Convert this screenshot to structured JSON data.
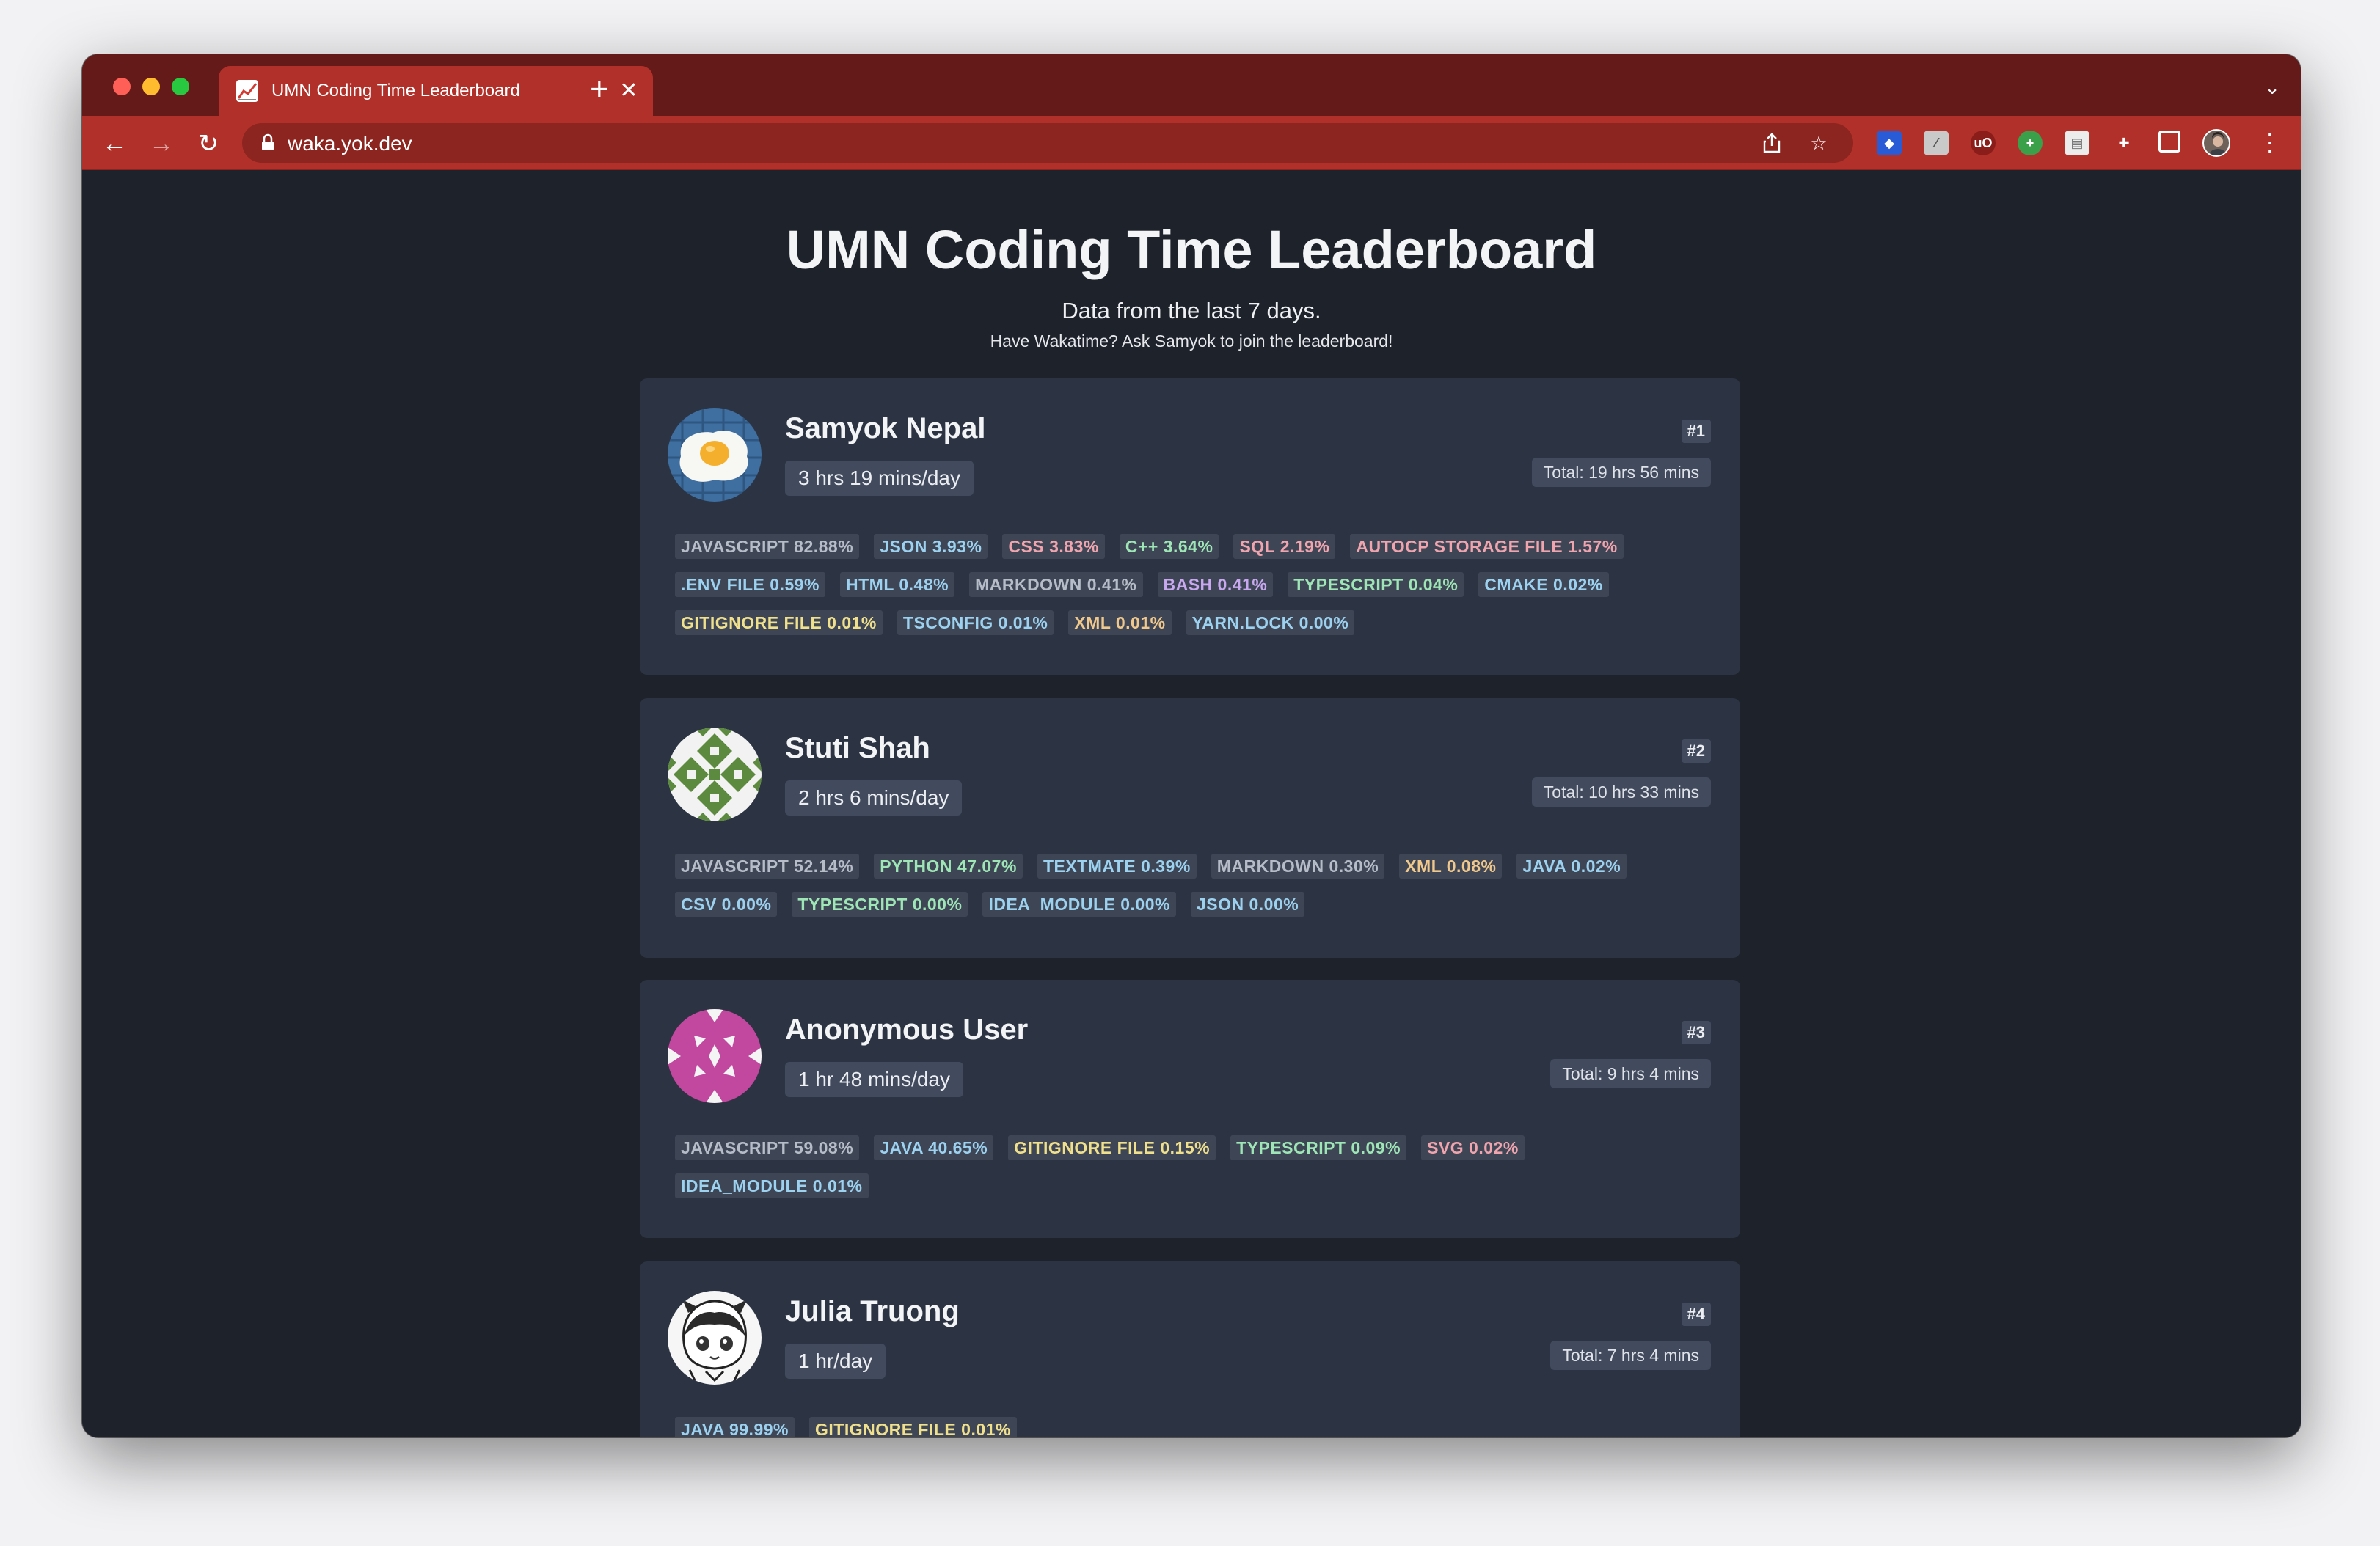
{
  "browser": {
    "tab_title": "UMN Coding Time Leaderboard",
    "url": "waka.yok.dev",
    "new_tab_symbol": "+",
    "close_symbol": "✕",
    "accent_color": "#b2302a",
    "tabstrip_color": "#641a18"
  },
  "page": {
    "title": "UMN Coding Time Leaderboard",
    "subtitle": "Data from the last 7 days.",
    "cta": "Have Wakatime? Ask Samyok to join the leaderboard!"
  },
  "leaderboard": [
    {
      "name": "Samyok Nepal",
      "daily": "3 hrs 19 mins/day",
      "rank": "#1",
      "total": "Total: 19 hrs 56 mins",
      "avatar": "fried-egg",
      "languages": [
        {
          "label": "JAVASCRIPT 82.88%",
          "color": "#b6bcc8"
        },
        {
          "label": "JSON 3.93%",
          "color": "#9cd2f0"
        },
        {
          "label": "CSS 3.83%",
          "color": "#f0a4ae"
        },
        {
          "label": "C++ 3.64%",
          "color": "#9ee6b6"
        },
        {
          "label": "SQL 2.19%",
          "color": "#f0a4ae"
        },
        {
          "label": "AUTOCP STORAGE FILE 1.57%",
          "color": "#f0a4ae"
        },
        {
          "label": ".ENV FILE 0.59%",
          "color": "#9cd2f0"
        },
        {
          "label": "HTML 0.48%",
          "color": "#9cd2f0"
        },
        {
          "label": "MARKDOWN 0.41%",
          "color": "#b6bcc8"
        },
        {
          "label": "BASH 0.41%",
          "color": "#c9a8f0"
        },
        {
          "label": "TYPESCRIPT 0.04%",
          "color": "#9ee6b6"
        },
        {
          "label": "CMAKE 0.02%",
          "color": "#9cd2f0"
        },
        {
          "label": "GITIGNORE FILE 0.01%",
          "color": "#f0e08c"
        },
        {
          "label": "TSCONFIG 0.01%",
          "color": "#9cd2f0"
        },
        {
          "label": "XML 0.01%",
          "color": "#f0c88c"
        },
        {
          "label": "YARN.LOCK 0.00%",
          "color": "#9cd2f0"
        }
      ]
    },
    {
      "name": "Stuti Shah",
      "daily": "2 hrs 6 mins/day",
      "rank": "#2",
      "total": "Total: 10 hrs 33 mins",
      "avatar": "green-pattern",
      "languages": [
        {
          "label": "JAVASCRIPT 52.14%",
          "color": "#b6bcc8"
        },
        {
          "label": "PYTHON 47.07%",
          "color": "#9ee6b6"
        },
        {
          "label": "TEXTMATE 0.39%",
          "color": "#9cd2f0"
        },
        {
          "label": "MARKDOWN 0.30%",
          "color": "#b6bcc8"
        },
        {
          "label": "XML 0.08%",
          "color": "#f0c88c"
        },
        {
          "label": "JAVA 0.02%",
          "color": "#9cd2f0"
        },
        {
          "label": "CSV 0.00%",
          "color": "#9cd2f0"
        },
        {
          "label": "TYPESCRIPT 0.00%",
          "color": "#9ee6b6"
        },
        {
          "label": "IDEA_MODULE 0.00%",
          "color": "#9cd2f0"
        },
        {
          "label": "JSON 0.00%",
          "color": "#9cd2f0"
        }
      ]
    },
    {
      "name": "Anonymous User",
      "daily": "1 hr 48 mins/day",
      "rank": "#3",
      "total": "Total: 9 hrs 4 mins",
      "avatar": "magenta-pattern",
      "languages": [
        {
          "label": "JAVASCRIPT 59.08%",
          "color": "#b6bcc8"
        },
        {
          "label": "JAVA 40.65%",
          "color": "#9cd2f0"
        },
        {
          "label": "GITIGNORE FILE 0.15%",
          "color": "#f0e08c"
        },
        {
          "label": "TYPESCRIPT 0.09%",
          "color": "#9ee6b6"
        },
        {
          "label": "SVG 0.02%",
          "color": "#f0a4ae"
        },
        {
          "label": "IDEA_MODULE 0.01%",
          "color": "#9cd2f0"
        }
      ]
    },
    {
      "name": "Julia Truong",
      "daily": "1 hr/day",
      "rank": "#4",
      "total": "Total: 7 hrs 4 mins",
      "avatar": "anime-sketch",
      "languages": [
        {
          "label": "JAVA 99.99%",
          "color": "#9cd2f0"
        },
        {
          "label": "GITIGNORE FILE 0.01%",
          "color": "#f0e08c"
        }
      ]
    }
  ]
}
